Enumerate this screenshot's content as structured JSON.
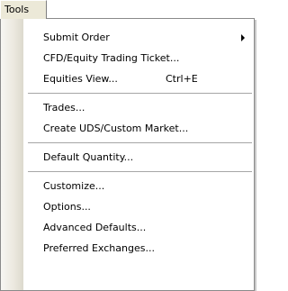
{
  "menubar": {
    "tab_label": "Tools"
  },
  "menu": {
    "groups": [
      {
        "items": [
          {
            "label": "Submit Order",
            "shortcut": "",
            "submenu": true
          },
          {
            "label": "CFD/Equity Trading Ticket...",
            "shortcut": "",
            "submenu": false
          },
          {
            "label": "Equities View...",
            "shortcut": "Ctrl+E",
            "submenu": false
          }
        ]
      },
      {
        "items": [
          {
            "label": "Trades...",
            "shortcut": "",
            "submenu": false
          },
          {
            "label": "Create UDS/Custom Market...",
            "shortcut": "",
            "submenu": false
          }
        ]
      },
      {
        "items": [
          {
            "label": "Default Quantity...",
            "shortcut": "",
            "submenu": false
          }
        ]
      },
      {
        "items": [
          {
            "label": "Customize...",
            "shortcut": "",
            "submenu": false
          },
          {
            "label": "Options...",
            "shortcut": "",
            "submenu": false
          },
          {
            "label": "Advanced Defaults...",
            "shortcut": "",
            "submenu": false
          },
          {
            "label": "Preferred Exchanges...",
            "shortcut": "",
            "submenu": false
          }
        ]
      }
    ]
  }
}
